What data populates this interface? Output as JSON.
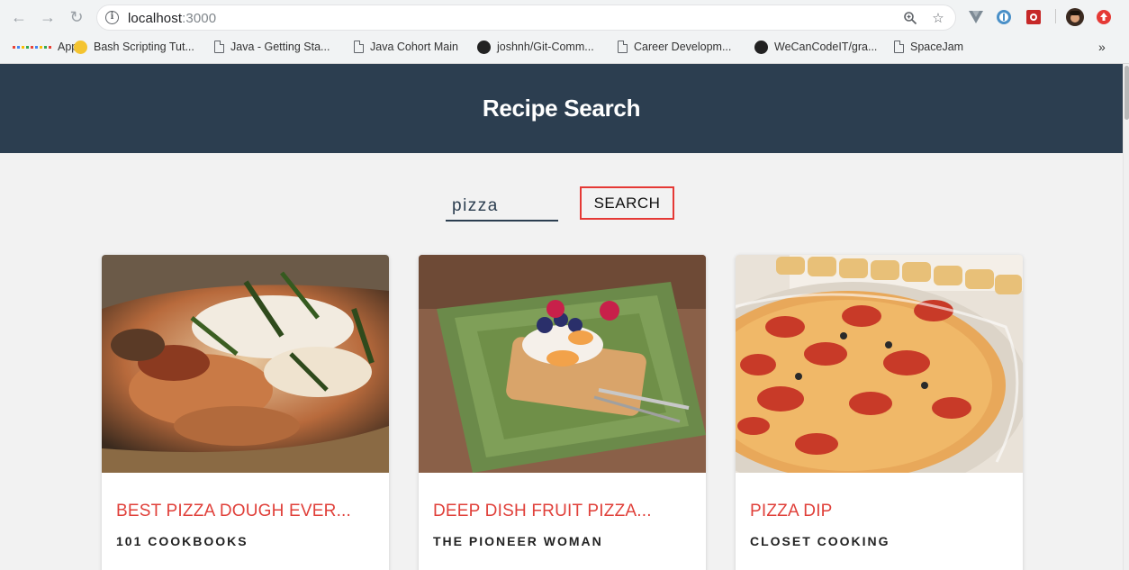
{
  "browser": {
    "url_host": "localhost",
    "url_port": ":3000",
    "bookmarks": [
      {
        "label": "Apps",
        "icon": "apps-grid-icon"
      },
      {
        "label": "Bash Scripting Tut...",
        "icon": "yellow-dot-icon"
      },
      {
        "label": "Java - Getting Sta...",
        "icon": "document-icon"
      },
      {
        "label": "Java Cohort Main",
        "icon": "document-icon"
      },
      {
        "label": "joshnh/Git-Comm...",
        "icon": "github-icon"
      },
      {
        "label": "Career Developm...",
        "icon": "document-icon"
      },
      {
        "label": "WeCanCodeIT/gra...",
        "icon": "github-icon"
      },
      {
        "label": "SpaceJam",
        "icon": "document-icon"
      }
    ],
    "more_bookmarks": "»"
  },
  "header": {
    "title": "Recipe Search"
  },
  "search": {
    "value": "pizza",
    "button_label": "SEARCH"
  },
  "recipes": [
    {
      "title": "BEST PIZZA DOUGH EVER...",
      "source": "101 COOKBOOKS"
    },
    {
      "title": "DEEP DISH FRUIT PIZZA...",
      "source": "THE PIONEER WOMAN"
    },
    {
      "title": "PIZZA DIP",
      "source": "CLOSET COOKING"
    }
  ],
  "colors": {
    "header_bg": "#2c3e50",
    "accent_red": "#e0403a",
    "page_bg": "#f2f2f2"
  }
}
